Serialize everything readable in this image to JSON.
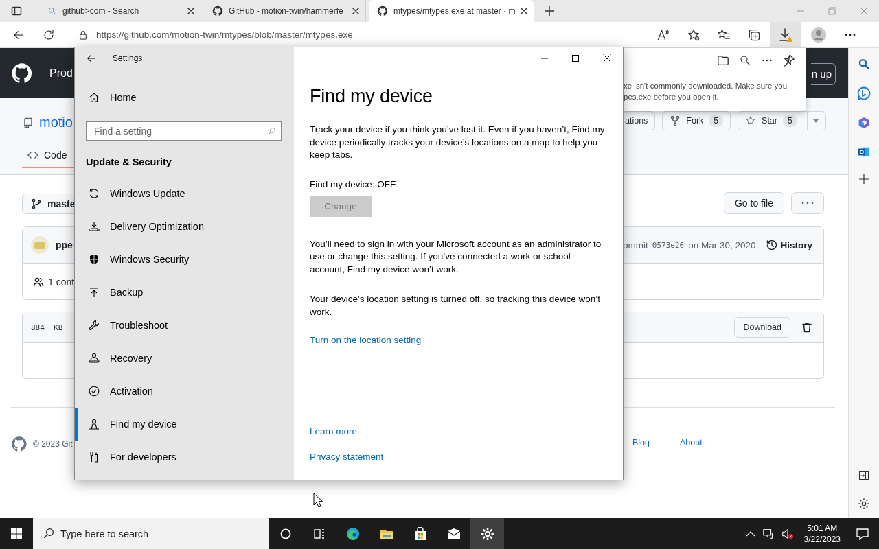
{
  "browser": {
    "tabs": [
      {
        "title": "github>com - Search",
        "kind": "search",
        "selected": false
      },
      {
        "title": "GitHub - motion-twin/hammerfe",
        "kind": "github",
        "selected": false
      },
      {
        "title": "mtypes/mtypes.exe at master · m",
        "kind": "github",
        "selected": true
      }
    ],
    "url": "https://github.com/motion-twin/mtypes/blob/master/mtypes.exe"
  },
  "github_page": {
    "header_text": "Prod",
    "repo_name": "motio",
    "code_tab": "Code",
    "branch": "maste",
    "commit_author": "ppe",
    "contributors": "1 cont",
    "file_size": "884  KB",
    "footer_copyright": "© 2023 Git",
    "signup_button": "n up",
    "repo_buttons": [
      {
        "label": "ations",
        "kind": "plain"
      },
      {
        "label": "Fork",
        "kind": "fork",
        "count": "5"
      },
      {
        "label": "Star",
        "kind": "star",
        "count": "5"
      }
    ],
    "go_to_file": "Go to file",
    "commit_prefix": "ommit",
    "commit_sha": "0573e26",
    "commit_date": "on Mar 30, 2020",
    "history": "History",
    "download": "Download",
    "footer_links": [
      "Blog",
      "About"
    ]
  },
  "download_panel": {
    "lines": [
      "xe isn't commonly downloaded. Make sure you",
      "pes.exe before you open it."
    ]
  },
  "settings": {
    "title": "Settings",
    "home": "Home",
    "search_placeholder": "Find a setting",
    "section": "Update & Security",
    "nav": [
      {
        "label": "Windows Update",
        "kind": "sync",
        "selected": false
      },
      {
        "label": "Delivery Optimization",
        "kind": "delivery",
        "selected": false
      },
      {
        "label": "Windows Security",
        "kind": "shield",
        "selected": false
      },
      {
        "label": "Backup",
        "kind": "backup",
        "selected": false
      },
      {
        "label": "Troubleshoot",
        "kind": "wrench",
        "selected": false
      },
      {
        "label": "Recovery",
        "kind": "recovery",
        "selected": false
      },
      {
        "label": "Activation",
        "kind": "activation",
        "selected": false
      },
      {
        "label": "Find my device",
        "kind": "find",
        "selected": true
      },
      {
        "label": "For developers",
        "kind": "developers",
        "selected": false
      }
    ],
    "page_title": "Find my device",
    "intro": "Track your device if you think you’ve lost it. Even if you haven’t, Find my device periodically tracks your device’s locations on a map to help you keep tabs.",
    "status": "Find my device: OFF",
    "change_button": {
      "label": "Change",
      "disabled": true
    },
    "account_note": "You’ll need to sign in with your Microsoft account as an administrator to use or change this setting. If you’ve connected a work or school account, Find my device won’t work.",
    "location_note": "Your device’s location setting is turned off, so tracking this device won’t work.",
    "location_link": "Turn on the location setting",
    "links": [
      "Learn more",
      "Privacy statement"
    ]
  },
  "taskbar": {
    "search_placeholder": "Type here to search",
    "apps": [
      {
        "kind": "cortana",
        "active": false
      },
      {
        "kind": "taskview",
        "active": false
      },
      {
        "kind": "edge",
        "active": false
      },
      {
        "kind": "explorer",
        "active": false
      },
      {
        "kind": "store",
        "active": false
      },
      {
        "kind": "mail",
        "active": false
      },
      {
        "kind": "settings",
        "active": true
      }
    ],
    "time": "5:01 AM",
    "date": "3/22/2023"
  }
}
